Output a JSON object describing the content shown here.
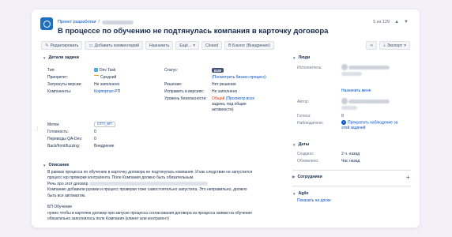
{
  "breadcrumb": {
    "project": "Проект разработки"
  },
  "issue": {
    "title": "В процессе по обучению не подтянулась компания в карточку договора"
  },
  "pager": {
    "text": "5 из 129"
  },
  "toolbar": {
    "edit": "Редактировать",
    "comment": "Добавить комментарий",
    "assign": "Назначить",
    "more": "Ещё...",
    "closed": "Closed",
    "backlog": "В Бэклог (Внедрение)",
    "export": "Экспорт"
  },
  "details": {
    "header": "Детали задачи",
    "fields": {
      "type_label": "Тип:",
      "type_value": "Dev Task",
      "priority_label": "Приоритет:",
      "priority_value": "Средний",
      "versions_label": "Затронуты версии:",
      "versions_value": "Не заполнено",
      "components_label": "Компоненты:",
      "components_value": "Корпортал-РП",
      "labels_label": "Метки:",
      "labels_value": "СТП_КП",
      "readiness_label": "Готовность:",
      "readiness_value": "0",
      "qadev_label": "Переводы QA-Dev:",
      "qadev_value": "0",
      "backfront_label": "Back/front/fuzzing:",
      "backfront_value": "Внедрение",
      "status_label": "Статус:",
      "status_value": "ВЗЯ",
      "status_link": "(Посмотреть бизнес-процесс)",
      "resolution_label": "Решение:",
      "resolution_value": "Нет решения",
      "fixversion_label": "Исправить в версиях:",
      "fixversion_value": "Не заполнено",
      "security_label": "Уровень безопасности:",
      "security_value_1": "Общий",
      "security_value_2": "(Просмотр всех",
      "security_value_3": "задача, под общие",
      "security_value_4": "активности)"
    }
  },
  "description": {
    "header": "Описание",
    "lines": [
      "В рамках процесса по обучению в карточку договора не подтянулась компания. И как следствие не запустился",
      "процесс юр проверки контрагента. Поле Компания должно быть обязательным.",
      "Речь про этот договор",
      "Компанию добавили руками и процесс проверки тоже самостоятельно запустила. Это неправильно, должно",
      "быть все автоматом.",
      "",
      "БП Обучение",
      "нужно чтобы в карточке договор при запуске процесса согласования договора из процесса заявки на обучение",
      "обязательно заполнялось поле Компания (клиент или контрагент)"
    ]
  },
  "people": {
    "header": "Люди",
    "assignee_label": "Исполнитель:",
    "assign_to_me": "Назначить меня",
    "reporter_label": "Автор:",
    "votes_label": "Голоса:",
    "votes_value": "0",
    "watchers_label": "Наблюдатели:",
    "watchers_value": "2",
    "stop_watch_1": "Прекратить наблюдение за",
    "stop_watch_2": "этой задачей"
  },
  "dates": {
    "header": "Даты",
    "created_label": "Создано:",
    "created_value": "2 ч. назад",
    "updated_label": "Обновлено:",
    "updated_value": "Час назад"
  },
  "employees": {
    "header": "Сотрудники"
  },
  "agile": {
    "header": "Agile",
    "board_link": "Показать на доске"
  },
  "colors": {
    "accent": "#0052cc",
    "background": "#f3f0f8"
  }
}
